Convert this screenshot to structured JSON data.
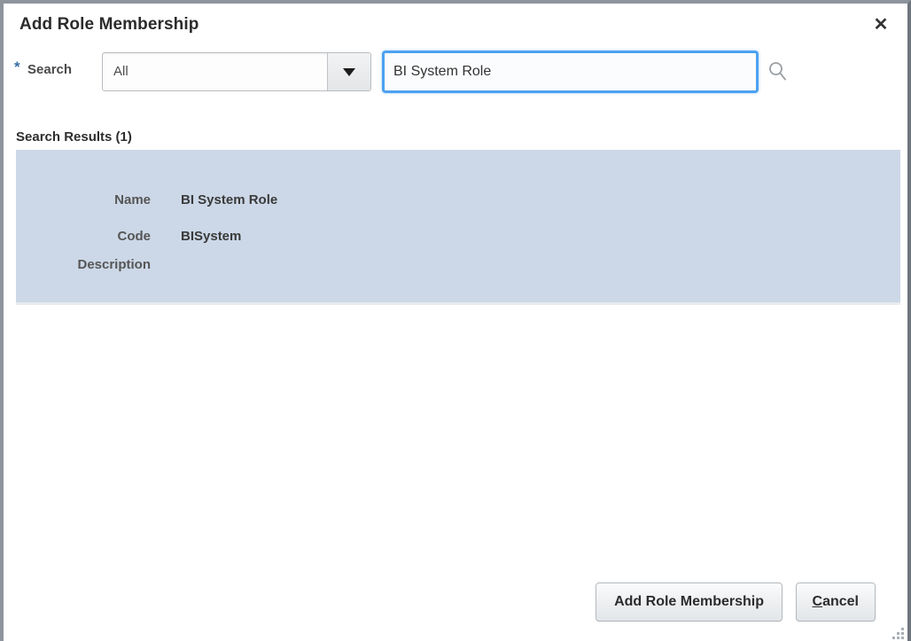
{
  "dialog": {
    "title": "Add Role Membership",
    "close_icon": "close-icon"
  },
  "search": {
    "required_marker": "*",
    "label": "Search",
    "scope_value": "All",
    "scope_options": [
      "All"
    ],
    "dropdown_icon": "chevron-down-icon",
    "query_value": "BI System Role",
    "query_placeholder": "",
    "search_icon": "search-icon"
  },
  "results": {
    "header": "Search Results (1)",
    "rows": [
      {
        "label": "Name",
        "value": "BI System Role"
      },
      {
        "label": "Code",
        "value": "BISystem"
      },
      {
        "label": "Description",
        "value": ""
      }
    ]
  },
  "footer": {
    "primary_label": "Add Role Membership",
    "cancel_label": "Cancel",
    "cancel_accesskey": "C",
    "cancel_rest": "ancel",
    "resize_icon": "resize-grip-icon"
  },
  "colors": {
    "focus_ring": "#4da2f0",
    "result_panel_bg": "#ccd8e7",
    "required_star": "#3a6ea5",
    "window_border": "#8d949c"
  }
}
